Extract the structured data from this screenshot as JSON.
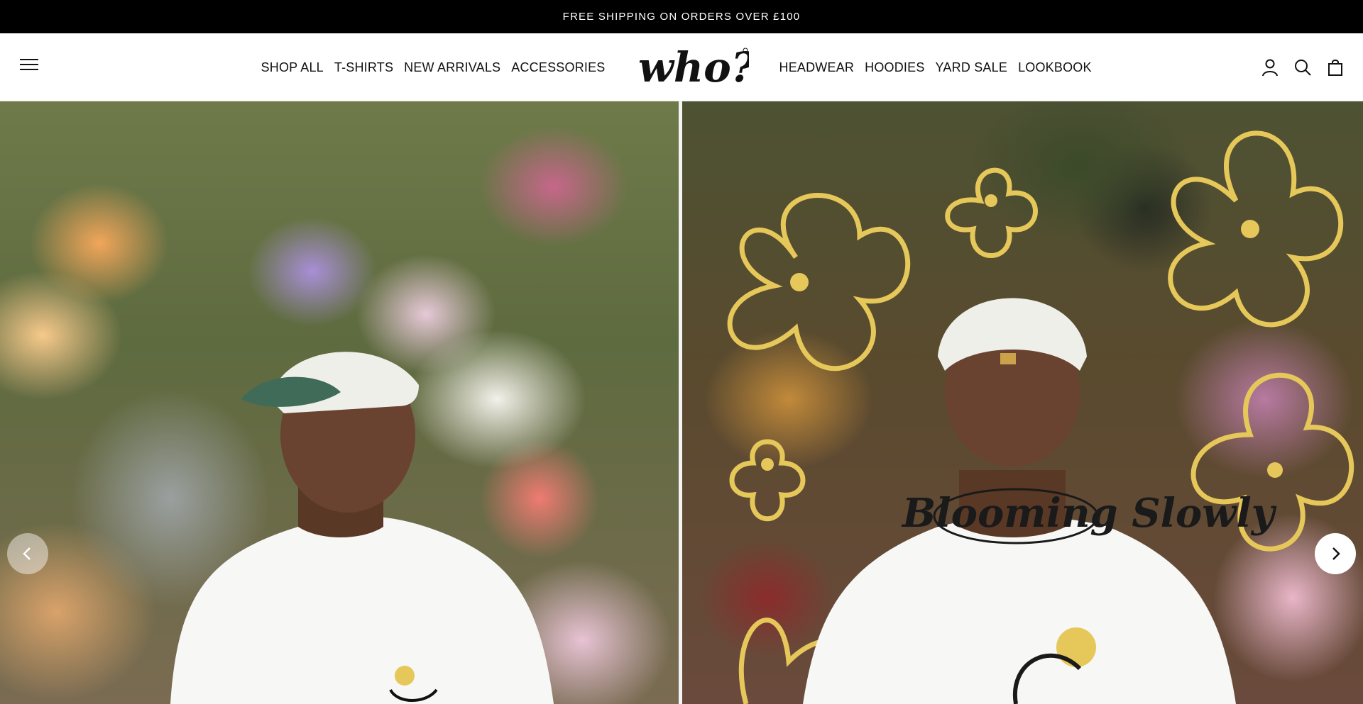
{
  "announcement": {
    "text": "FREE SHIPPING ON ORDERS OVER £100"
  },
  "header": {
    "nav_left": [
      {
        "label": "SHOP ALL"
      },
      {
        "label": "T-SHIRTS"
      },
      {
        "label": "NEW ARRIVALS"
      },
      {
        "label": "ACCESSORIES"
      }
    ],
    "logo_text": "who?",
    "nav_right": [
      {
        "label": "HEADWEAR"
      },
      {
        "label": "HOODIES"
      },
      {
        "label": "YARD SALE"
      },
      {
        "label": "LOOKBOOK"
      }
    ],
    "icons": [
      "menu-icon",
      "account-icon",
      "search-icon",
      "cart-icon"
    ]
  },
  "hero": {
    "slide_right": {
      "tshirt_print": "Blooming Slowly"
    },
    "arrows": [
      "chevron-left-icon",
      "chevron-right-icon"
    ]
  },
  "colors": {
    "announcement_bg": "#000000",
    "header_bg": "#ffffff",
    "doodle_yellow": "#e6c75a"
  }
}
